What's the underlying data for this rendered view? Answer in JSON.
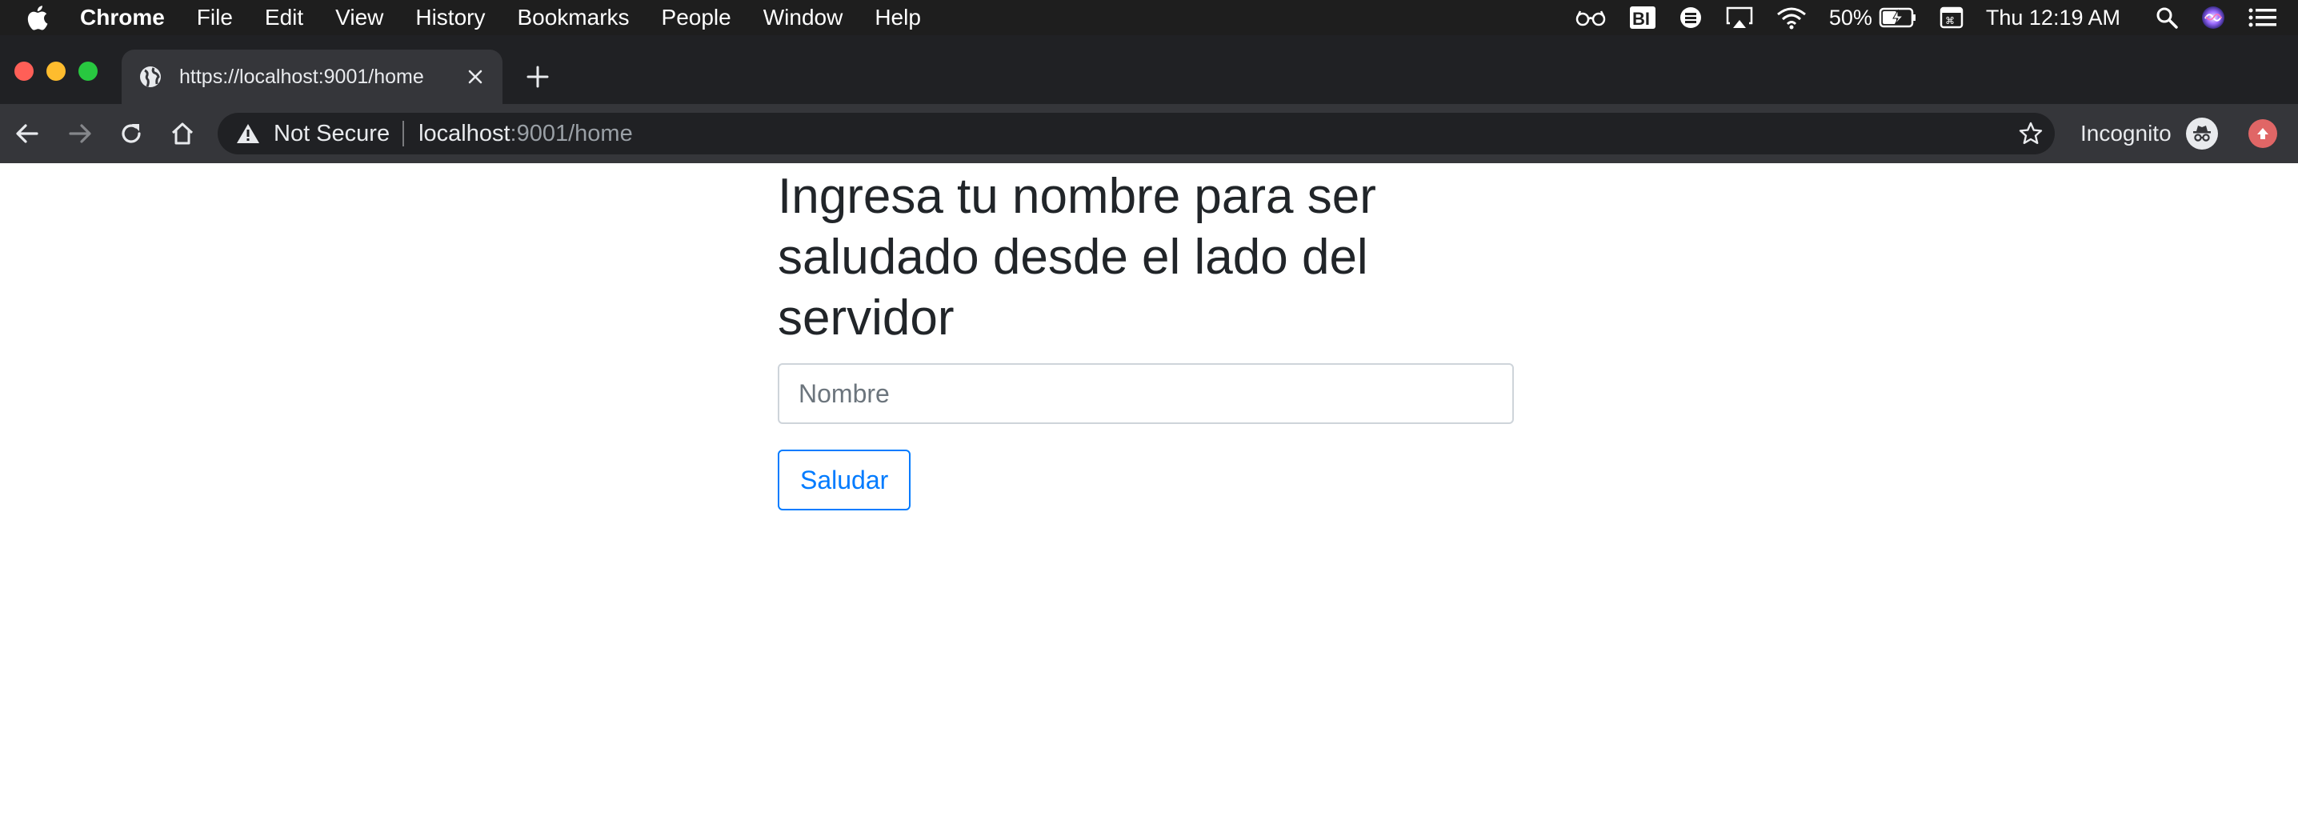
{
  "menubar": {
    "app_name": "Chrome",
    "menus": [
      "File",
      "Edit",
      "View",
      "History",
      "Bookmarks",
      "People",
      "Window",
      "Help"
    ],
    "battery_text": "50%",
    "clock": "Thu 12:19 AM",
    "status_icons": [
      "glasses-icon",
      "bi-icon",
      "keyboard-layout-icon",
      "airplay-icon",
      "wifi-icon",
      "battery-charging-icon",
      "display-icon",
      "search-icon",
      "siri-icon",
      "notification-center-icon"
    ]
  },
  "tab": {
    "title": "https://localhost:9001/home"
  },
  "omnibox": {
    "security_label": "Not Secure",
    "host": "localhost",
    "rest": ":9001/home"
  },
  "profile": {
    "label": "Incognito"
  },
  "page": {
    "heading": "Ingresa tu nombre para ser saludado desde el lado del servidor",
    "input_placeholder": "Nombre",
    "input_value": "",
    "button_label": "Saludar"
  },
  "colors": {
    "menubar_bg": "#1e1e1e",
    "tabstrip_bg": "#202124",
    "toolbar_bg": "#35363a",
    "primary": "#007bff",
    "heading_text": "#212529"
  }
}
